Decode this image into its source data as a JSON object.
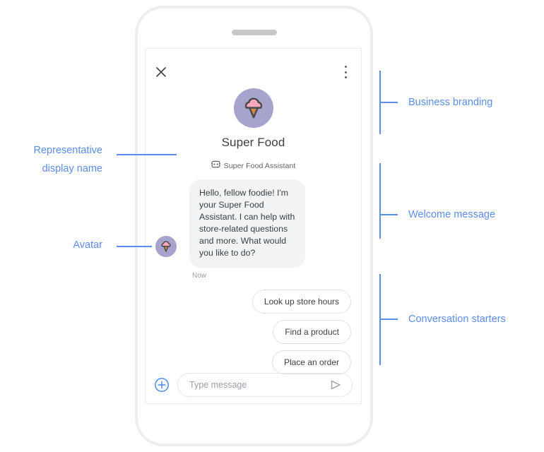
{
  "device": {
    "speaker_grille": "speaker-grille"
  },
  "chat": {
    "topbar": {
      "close_label": "Close",
      "menu_label": "More options"
    },
    "branding": {
      "business_name": "Super Food",
      "logo_icon": "ice-cream-cone-icon",
      "logo_circle_color": "#a6a3cd",
      "scoop_color": "#f7a8bd",
      "cone_color": "#c98a4b",
      "outline_color": "#4a4a4a"
    },
    "representative": {
      "badge_icon": "bot-face-icon",
      "display_name": "Super Food Assistant"
    },
    "welcome": {
      "text": "Hello, fellow foodie! I'm your Super Food Assistant. I can help with store-related questions and more. What would you like to do?",
      "timestamp": "Now",
      "avatar_icon": "ice-cream-cone-icon",
      "bubble_color": "#f1f3f4"
    },
    "starters": [
      {
        "label": "Look up store hours"
      },
      {
        "label": "Find a product"
      },
      {
        "label": "Place an order"
      }
    ],
    "input": {
      "placeholder": "Type message",
      "value": "",
      "add_icon": "plus-circle-icon",
      "send_icon": "send-arrow-icon",
      "add_icon_color": "#4285f4",
      "send_icon_color": "#9aa0a6"
    }
  },
  "annotations": {
    "accent_color": "#5b8def",
    "left": [
      {
        "name": "representative-display-name",
        "line1": "Representative",
        "line2": "display name"
      },
      {
        "name": "avatar",
        "line1": "Avatar",
        "line2": ""
      }
    ],
    "right": [
      {
        "name": "business-branding",
        "label": "Business branding"
      },
      {
        "name": "welcome-message",
        "label": "Welcome message"
      },
      {
        "name": "conversation-starters",
        "label": "Conversation starters"
      }
    ]
  }
}
